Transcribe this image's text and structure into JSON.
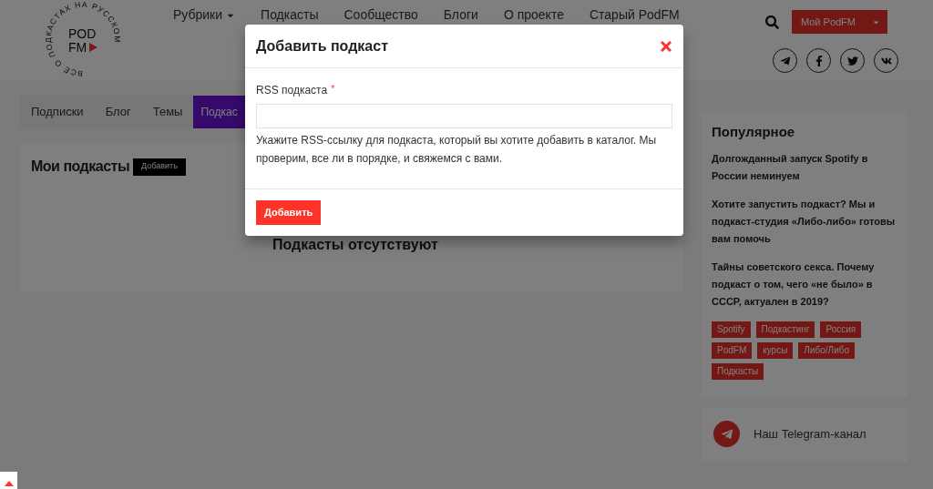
{
  "header": {
    "logo": {
      "ring_text": "ВСЁ О ПОДКАСТАХ НА РУССКОМ",
      "line1": "POD",
      "line2": "FM"
    },
    "nav": [
      {
        "label": "Рубрики",
        "kind": "dropdown"
      },
      {
        "label": "Подкасты",
        "kind": "link"
      },
      {
        "label": "Сообщество",
        "kind": "link"
      },
      {
        "label": "Блоги",
        "kind": "link"
      },
      {
        "label": "О проекте",
        "kind": "link"
      },
      {
        "label": "Старый PodFM",
        "kind": "link"
      }
    ],
    "account_button": "Мой PodFM"
  },
  "tabs": [
    {
      "label": "Подписки",
      "selected": false
    },
    {
      "label": "Блог",
      "selected": false
    },
    {
      "label": "Темы",
      "selected": false
    },
    {
      "label": "Подкас",
      "selected": true
    }
  ],
  "main": {
    "title": "Мои подкасты",
    "add_button": "Добавить",
    "empty": "Подкасты отсутствуют"
  },
  "sidebar": {
    "popular": {
      "title": "Популярное",
      "posts": [
        "Долгожданный запуск Spotify в России неминуем",
        "Хотите запустить подкаст? Мы и подкаст-студия «Либо-либо» готовы вам помочь",
        "Тайны советского секса. Почему подкаст о том, чего «не было» в СССР, актуален в 2019?"
      ],
      "tags": [
        "Spotify",
        "Подкастинг",
        "Россия",
        "PodFM",
        "курсы",
        "Либо/Либо",
        "Подкасты"
      ]
    },
    "telegram": "Наш Telegram-канал"
  },
  "modal": {
    "title": "Добавить подкаст",
    "field": {
      "label": "RSS подкаста",
      "required": true,
      "required_mark": "*",
      "hint": "Укажите RSS-ссылку для подкаста, который вы хотите добавить в каталог. Мы проверим, все ли в порядке, и свяжемся с вами."
    },
    "submit": "Добавить"
  }
}
